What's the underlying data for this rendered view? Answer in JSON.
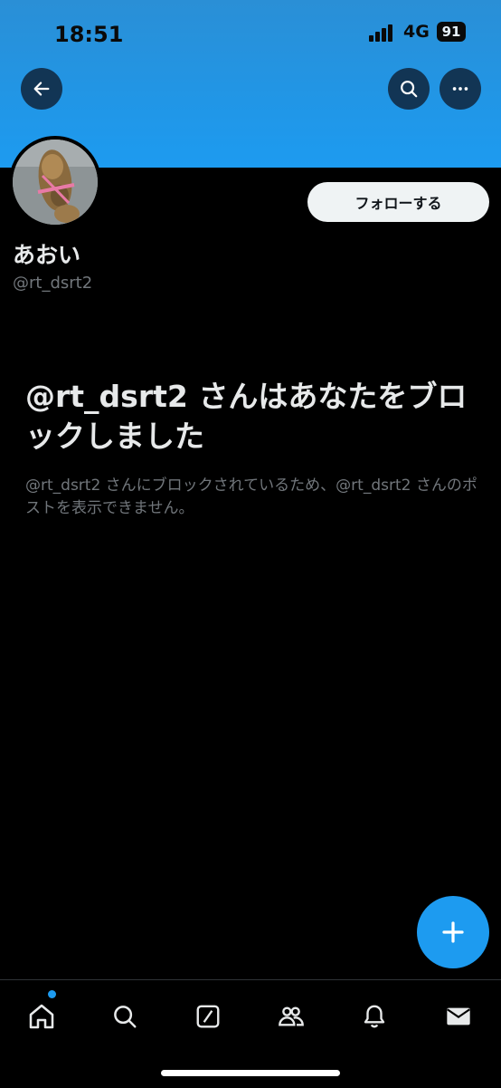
{
  "status_bar": {
    "time": "18:51",
    "network": "4G",
    "battery": "91"
  },
  "header": {
    "back_icon": "arrow-left-icon",
    "search_icon": "search-icon",
    "more_icon": "more-horizontal-icon",
    "banner_color": "#1d9bf0"
  },
  "profile": {
    "display_name": "あおい",
    "handle": "@rt_dsrt2",
    "follow_label": "フォローする"
  },
  "blocked": {
    "title": "@rt_dsrt2 さんはあなたをブロックしました",
    "description": "@rt_dsrt2 さんにブロックされているため、@rt_dsrt2 さんのポストを表示できません。"
  },
  "fab": {
    "icon": "plus-icon"
  },
  "tabbar": {
    "items": [
      {
        "icon": "home-icon",
        "has_dot": true
      },
      {
        "icon": "search-icon"
      },
      {
        "icon": "grok-icon"
      },
      {
        "icon": "communities-icon"
      },
      {
        "icon": "notifications-icon"
      },
      {
        "icon": "messages-icon"
      }
    ]
  },
  "colors": {
    "accent": "#1d9bf0",
    "background": "#000000",
    "text_primary": "#e7e9ea",
    "text_secondary": "#71767b"
  }
}
